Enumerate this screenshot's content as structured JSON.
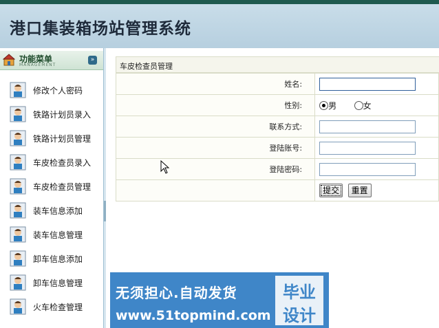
{
  "header": {
    "title": "港口集装箱场站管理系统"
  },
  "sidebar": {
    "heading": "功能菜单",
    "heading_sub": "MANAGEMENT",
    "toggle_glyph": "»",
    "items": [
      {
        "label": "修改个人密码"
      },
      {
        "label": "铁路计划员录入"
      },
      {
        "label": "铁路计划员管理"
      },
      {
        "label": "车皮检查员录入"
      },
      {
        "label": "车皮检查员管理"
      },
      {
        "label": "装车信息添加"
      },
      {
        "label": "装车信息管理"
      },
      {
        "label": "卸车信息添加"
      },
      {
        "label": "卸车信息管理"
      },
      {
        "label": "火车检查管理"
      }
    ]
  },
  "form": {
    "title": "车皮检查员管理",
    "name_label": "姓名:",
    "name_value": "",
    "gender_label": "性别:",
    "gender_male": "男",
    "gender_female": "女",
    "gender_selected": "男",
    "contact_label": "联系方式:",
    "contact_value": "",
    "account_label": "登陆账号:",
    "account_value": "",
    "password_label": "登陆密码:",
    "password_value": "",
    "submit_label": "提交",
    "reset_label": "重置"
  },
  "watermark": {
    "line1": "无须担心.自动发货",
    "line2": "www.51topmind.com",
    "badge_top": "毕业",
    "badge_bottom": "设计"
  },
  "colors": {
    "header_bg": "#c9dde9",
    "topbar": "#1f5a4e",
    "watermark_bg": "#3f86c8"
  }
}
